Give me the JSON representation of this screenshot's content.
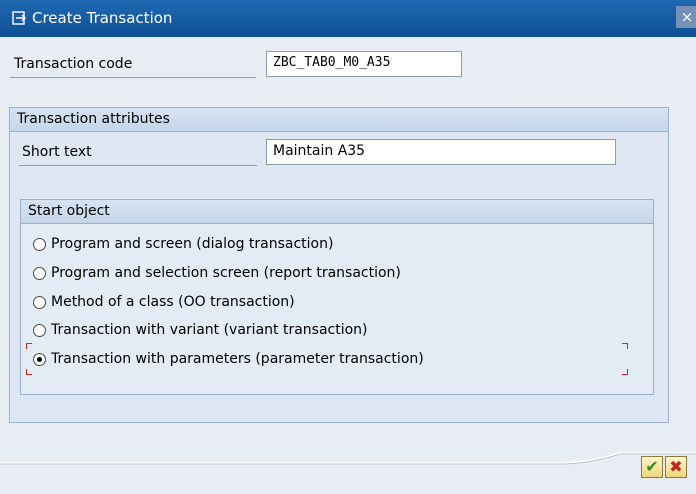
{
  "window": {
    "title": "Create Transaction",
    "title_icon": "create-transaction-icon",
    "close_glyph": "×",
    "titlebar_color": "#0f4f93"
  },
  "transaction": {
    "label": "Transaction code",
    "value": "ZBC_TAB0_M0_A35"
  },
  "attributes": {
    "header": "Transaction attributes",
    "short_text_label": "Short text",
    "short_text_value": "Maintain A35"
  },
  "start_object": {
    "header": "Start object",
    "options": [
      {
        "label": "Program and screen (dialog transaction)",
        "selected": false
      },
      {
        "label": "Program and selection screen (report transaction)",
        "selected": false
      },
      {
        "label": "Method of a class (OO transaction)",
        "selected": false
      },
      {
        "label": "Transaction with variant (variant transaction)",
        "selected": false
      },
      {
        "label": "Transaction with parameters (parameter transaction)",
        "selected": true
      }
    ],
    "focus_color": "#d7261c"
  },
  "buttons": {
    "ok_icon": "checkmark-icon",
    "cancel_icon": "cancel-icon",
    "ok_glyph": "✔",
    "cancel_glyph": "✖",
    "ok_color": "#2e8b1e",
    "cancel_color": "#c0231a"
  }
}
